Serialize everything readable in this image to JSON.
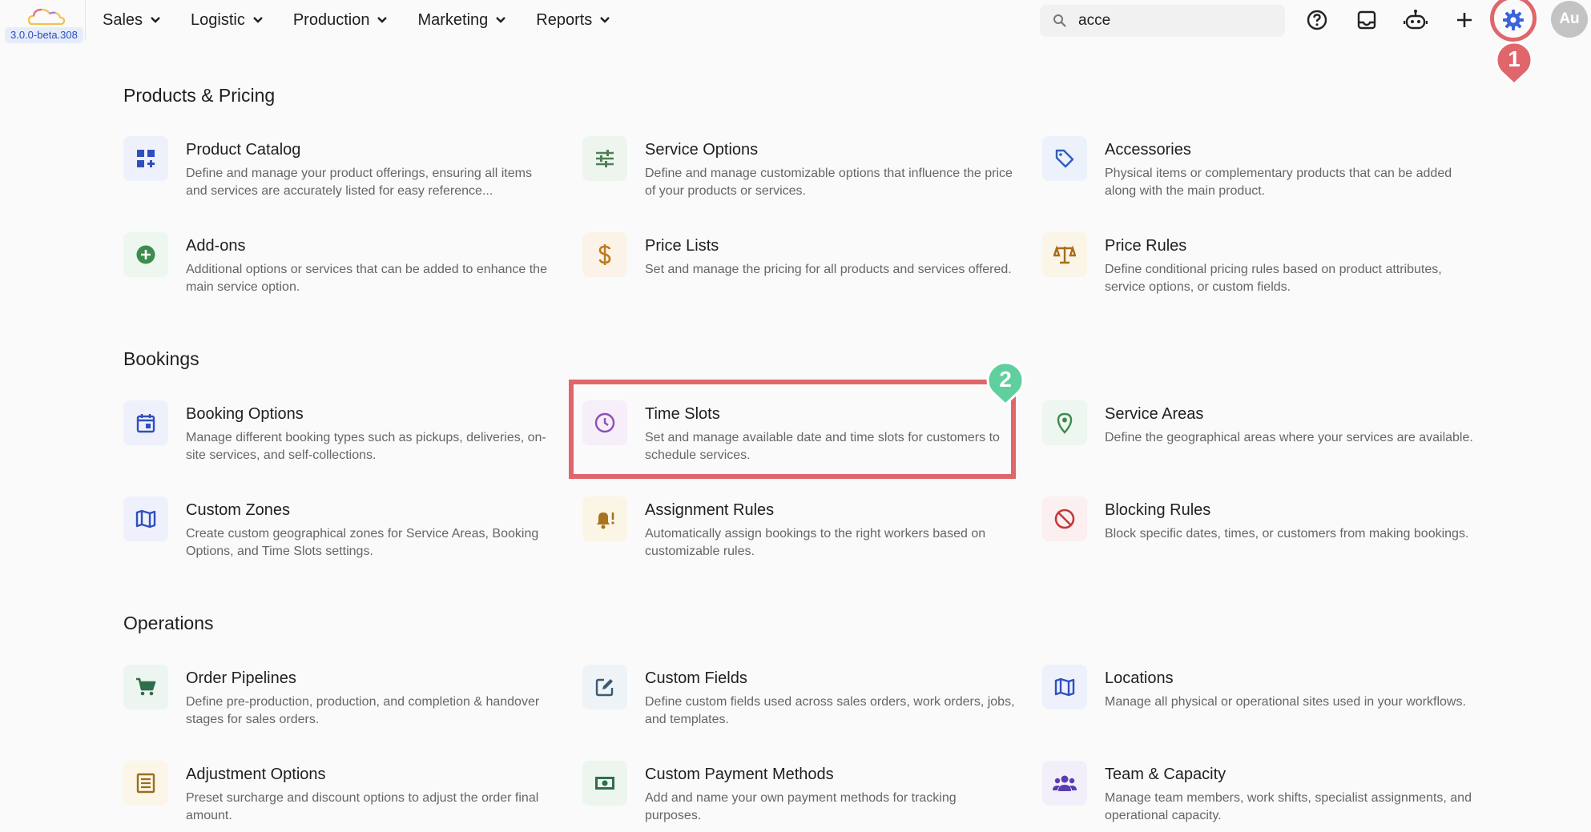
{
  "app": {
    "version": "3.0.0-beta.308"
  },
  "nav": {
    "items": [
      "Sales",
      "Logistic",
      "Production",
      "Marketing",
      "Reports"
    ]
  },
  "search": {
    "value": "acce"
  },
  "user": {
    "avatar_initials": "Au"
  },
  "annotations": {
    "marker_1": "1",
    "marker_2": "2"
  },
  "colors": {
    "annotation_red": "#e0666b",
    "annotation_green": "#5fcf9e"
  },
  "sections": [
    {
      "title": "Products & Pricing",
      "cards": [
        {
          "title": "Product Catalog",
          "desc": "Define and manage your product offerings, ensuring all items and services are accurately listed for easy reference...",
          "icon": "grid-plus-icon"
        },
        {
          "title": "Service Options",
          "desc": "Define and manage customizable options that influence the price of your products or services.",
          "icon": "sliders-icon"
        },
        {
          "title": "Accessories",
          "desc": "Physical items or complementary products that can be added along with the main product.",
          "icon": "tag-icon"
        },
        {
          "title": "Add-ons",
          "desc": "Additional options or services that can be added to enhance the main service option.",
          "icon": "plus-circle-icon"
        },
        {
          "title": "Price Lists",
          "desc": "Set and manage the pricing for all products and services offered.",
          "icon": "dollar-icon"
        },
        {
          "title": "Price Rules",
          "desc": "Define conditional pricing rules based on product attributes, service options, or custom fields.",
          "icon": "scale-icon"
        }
      ]
    },
    {
      "title": "Bookings",
      "cards": [
        {
          "title": "Booking Options",
          "desc": "Manage different booking types such as pickups, deliveries, on-site services, and self-collections.",
          "icon": "calendar-icon"
        },
        {
          "title": "Time Slots",
          "desc": "Set and manage available date and time slots for customers to schedule services.",
          "icon": "clock-icon"
        },
        {
          "title": "Service Areas",
          "desc": "Define the geographical areas where your services are available.",
          "icon": "location-pin-icon"
        },
        {
          "title": "Custom Zones",
          "desc": "Create custom geographical zones for Service Areas, Booking Options, and Time Slots settings.",
          "icon": "map-icon"
        },
        {
          "title": "Assignment Rules",
          "desc": "Automatically assign bookings to the right workers based on customizable rules.",
          "icon": "bell-alert-icon"
        },
        {
          "title": "Blocking Rules",
          "desc": "Block specific dates, times, or customers from making bookings.",
          "icon": "block-icon"
        }
      ]
    },
    {
      "title": "Operations",
      "cards": [
        {
          "title": "Order Pipelines",
          "desc": "Define pre-production, production, and completion & handover stages for sales orders.",
          "icon": "cart-icon"
        },
        {
          "title": "Custom Fields",
          "desc": "Define custom fields used across sales orders, work orders, jobs, and templates.",
          "icon": "edit-icon"
        },
        {
          "title": "Locations",
          "desc": "Manage all physical or operational sites used in your workflows.",
          "icon": "map-icon"
        },
        {
          "title": "Adjustment Options",
          "desc": "Preset surcharge and discount options to adjust the order final amount.",
          "icon": "list-icon"
        },
        {
          "title": "Custom Payment Methods",
          "desc": "Add and name your own payment methods for tracking purposes.",
          "icon": "cash-icon"
        },
        {
          "title": "Team & Capacity",
          "desc": "Manage team members, work shifts, specialist assignments, and operational capacity.",
          "icon": "team-icon"
        }
      ]
    }
  ]
}
